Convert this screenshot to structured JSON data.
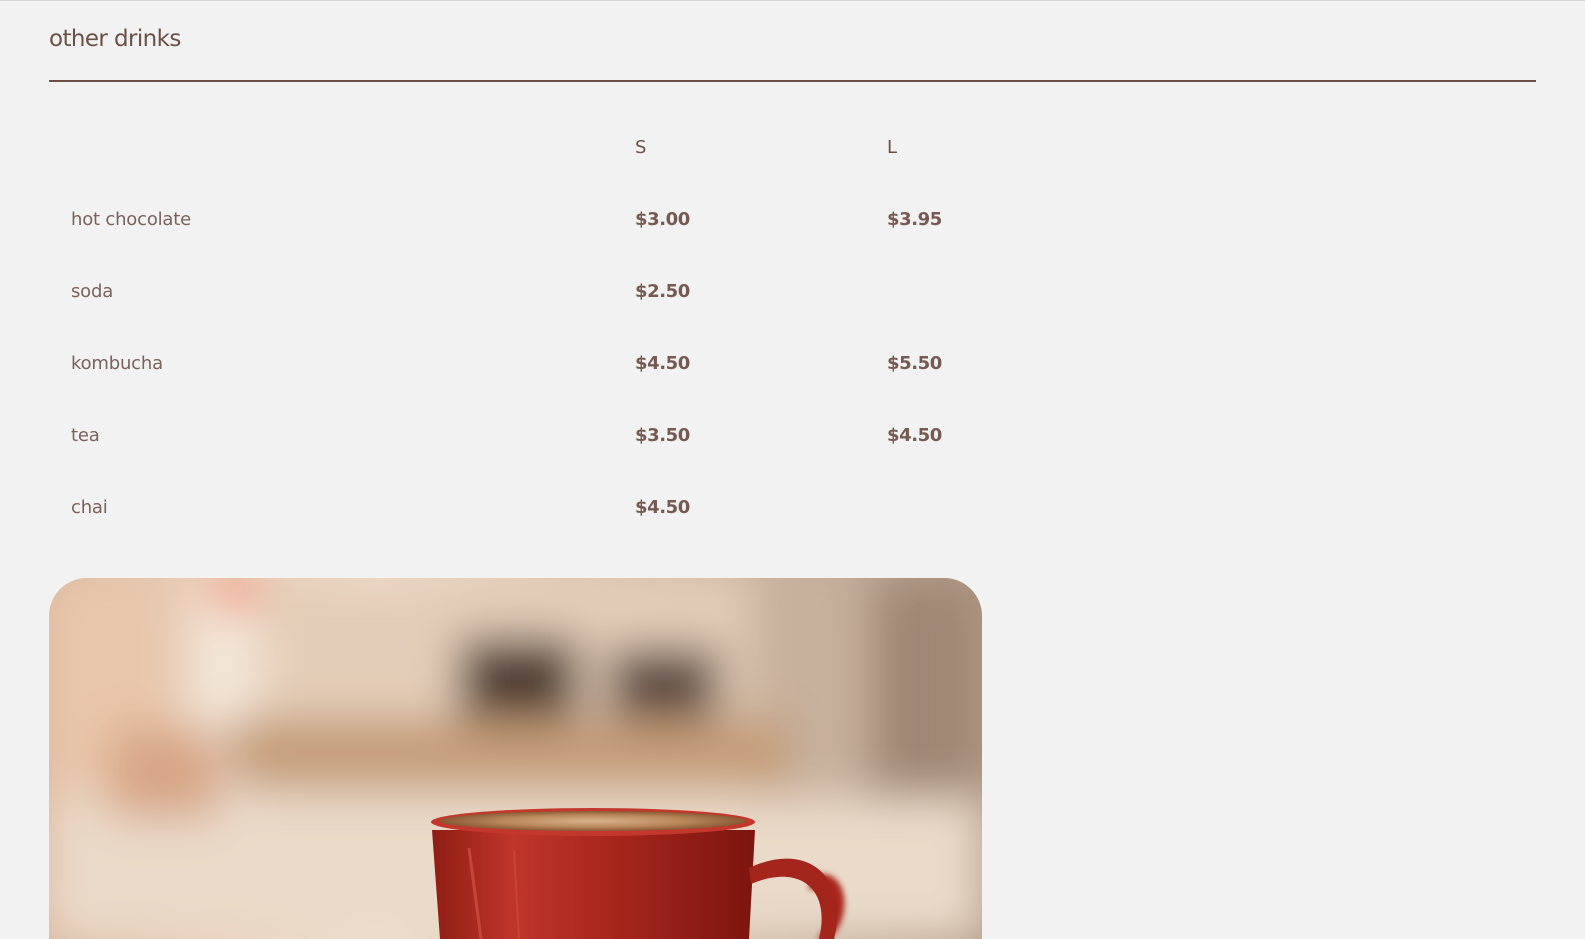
{
  "section": {
    "title": "other drinks"
  },
  "menu": {
    "headers": {
      "item": "",
      "small": "S",
      "large": "L"
    },
    "items": [
      {
        "name": "hot chocolate",
        "small": "$3.00",
        "large": "$3.95"
      },
      {
        "name": "soda",
        "small": "$2.50",
        "large": ""
      },
      {
        "name": "kombucha",
        "small": "$4.50",
        "large": "$5.50"
      },
      {
        "name": "tea",
        "small": "$3.50",
        "large": "$4.50"
      },
      {
        "name": "chai",
        "small": "$4.50",
        "large": ""
      }
    ]
  },
  "colors": {
    "background": "#f2f2f2",
    "text_brown": "#6b5048",
    "rule": "#6e4e44",
    "cup_red": "#b0271f"
  }
}
